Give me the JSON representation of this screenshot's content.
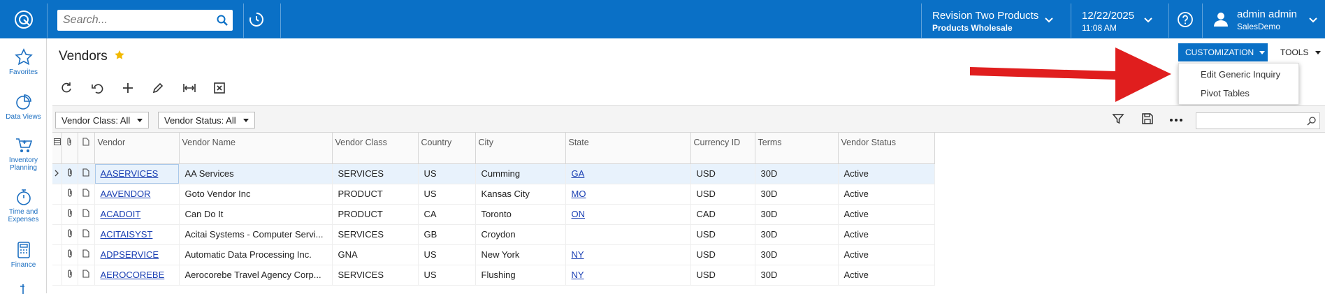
{
  "header": {
    "search_placeholder": "Search...",
    "company_line1": "Revision Two Products",
    "company_line2": "Products Wholesale",
    "date": "12/22/2025",
    "time": "11:08 AM",
    "user_name": "admin admin",
    "user_company": "SalesDemo",
    "accent_color": "#0a70c6"
  },
  "sidebar": {
    "items": [
      {
        "label": "Favorites",
        "icon": "star-icon"
      },
      {
        "label": "Data Views",
        "icon": "pie-chart-icon"
      },
      {
        "label": "Inventory Planning",
        "icon": "cart-icon"
      },
      {
        "label": "Time and Expenses",
        "icon": "stopwatch-icon"
      },
      {
        "label": "Finance",
        "icon": "calculator-icon"
      }
    ]
  },
  "page": {
    "title": "Vendors",
    "customization_label": "CUSTOMIZATION",
    "tools_label": "TOOLS",
    "menu_items": [
      "Edit Generic Inquiry",
      "Pivot Tables"
    ]
  },
  "filters": {
    "vendor_class": "Vendor Class: All",
    "vendor_status": "Vendor Status: All"
  },
  "grid": {
    "columns": [
      "Vendor",
      "Vendor Name",
      "Vendor Class",
      "Country",
      "City",
      "State",
      "Currency ID",
      "Terms",
      "Vendor Status"
    ],
    "rows": [
      [
        "AASERVICES",
        "AA Services",
        "SERVICES",
        "US",
        "Cumming",
        "GA",
        "USD",
        "30D",
        "Active"
      ],
      [
        "AAVENDOR",
        "Goto Vendor Inc",
        "PRODUCT",
        "US",
        "Kansas City",
        "MO",
        "USD",
        "30D",
        "Active"
      ],
      [
        "ACADOIT",
        "Can Do It",
        "PRODUCT",
        "CA",
        "Toronto",
        "ON",
        "CAD",
        "30D",
        "Active"
      ],
      [
        "ACITAISYST",
        "Acitai Systems - Computer Servi...",
        "SERVICES",
        "GB",
        "Croydon",
        "",
        "USD",
        "30D",
        "Active"
      ],
      [
        "ADPSERVICE",
        "Automatic Data Processing Inc.",
        "GNA",
        "US",
        "New York",
        "NY",
        "USD",
        "30D",
        "Active"
      ],
      [
        "AEROCOREBE",
        "Aerocorebe Travel Agency Corp...",
        "SERVICES",
        "US",
        "Flushing",
        "NY",
        "USD",
        "30D",
        "Active"
      ]
    ]
  }
}
